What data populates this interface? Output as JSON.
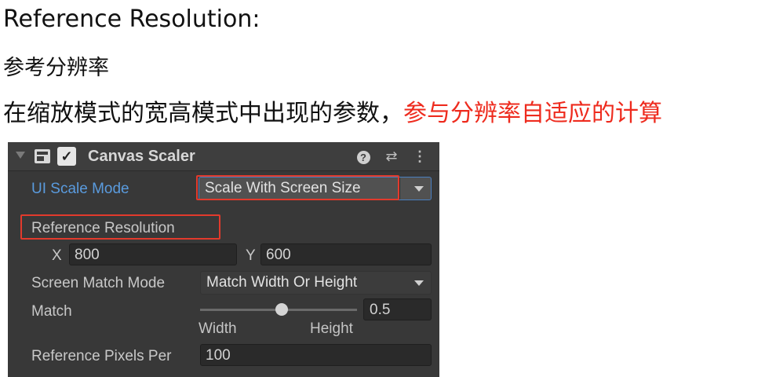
{
  "texts": {
    "heading": "Reference Resolution:",
    "subheading": "参考分辨率",
    "description_prefix": "在缩放模式的宽高模式中出现的参数，",
    "description_highlight": "参与分辨率自适应的计算"
  },
  "colors": {
    "highlight_text": "#ee2b1e",
    "annotation_box": "#e23a2c",
    "label_blue": "#5a9bde",
    "panel_bg": "#383838"
  },
  "component": {
    "title": "Canvas Scaler",
    "enabled_check": "✓",
    "icons": [
      "component-icon",
      "help-icon",
      "preset-icon",
      "kebab-menu-icon"
    ],
    "help_glyph": "?",
    "preset_glyph": "⇄",
    "kebab_glyph": "⋮"
  },
  "ui_scale_mode": {
    "label": "UI Scale Mode",
    "value": "Scale With Screen Size"
  },
  "reference_resolution": {
    "label": "Reference Resolution",
    "x_label": "X",
    "x_value": "800",
    "y_label": "Y",
    "y_value": "600"
  },
  "screen_match_mode": {
    "label": "Screen Match Mode",
    "value": "Match Width Or Height"
  },
  "match": {
    "label": "Match",
    "value": "0.5",
    "slider_fraction": 0.5,
    "min_label": "Width",
    "max_label": "Height"
  },
  "reference_pixels_per_unit": {
    "label": "Reference Pixels Per",
    "value": "100"
  }
}
